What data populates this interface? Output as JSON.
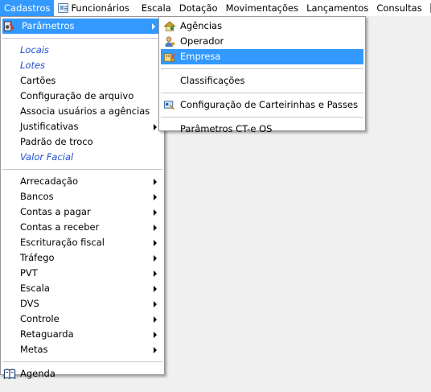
{
  "menubar": {
    "items": [
      {
        "label": "Cadastros",
        "active": true
      },
      {
        "label": "Funcionários",
        "icon": "employee-card-icon"
      },
      {
        "label": "Escala"
      },
      {
        "label": "Dotação"
      },
      {
        "label": "Movimentações"
      },
      {
        "label": "Lançamentos"
      },
      {
        "label": "Consultas"
      }
    ]
  },
  "cadastros_menu": {
    "parametros": "Parâmetros",
    "group1": [
      "Locais",
      "Lotes",
      "Cartões",
      "Configuração de arquivo",
      "Associa usuários a agências",
      "Justificativas",
      "Padrão de troco",
      "Valor Facial"
    ],
    "group2": [
      "Arrecadação",
      "Bancos",
      "Contas a pagar",
      "Contas a receber",
      "Escrituração fiscal",
      "Tráfego",
      "PVT",
      "Escala",
      "DVS",
      "Controle",
      "Retaguarda",
      "Metas"
    ],
    "agenda": "Agenda"
  },
  "parametros_menu": {
    "items": [
      "Agências",
      "Operador",
      "Empresa"
    ],
    "classificacoes": "Classificações",
    "carteirinhas": "Configuração de Carteirinhas e Passes",
    "ctee": "Parâmetros CT-e OS"
  },
  "colors": {
    "highlight": "#3399ff",
    "italic_link": "#1f4fd1"
  }
}
